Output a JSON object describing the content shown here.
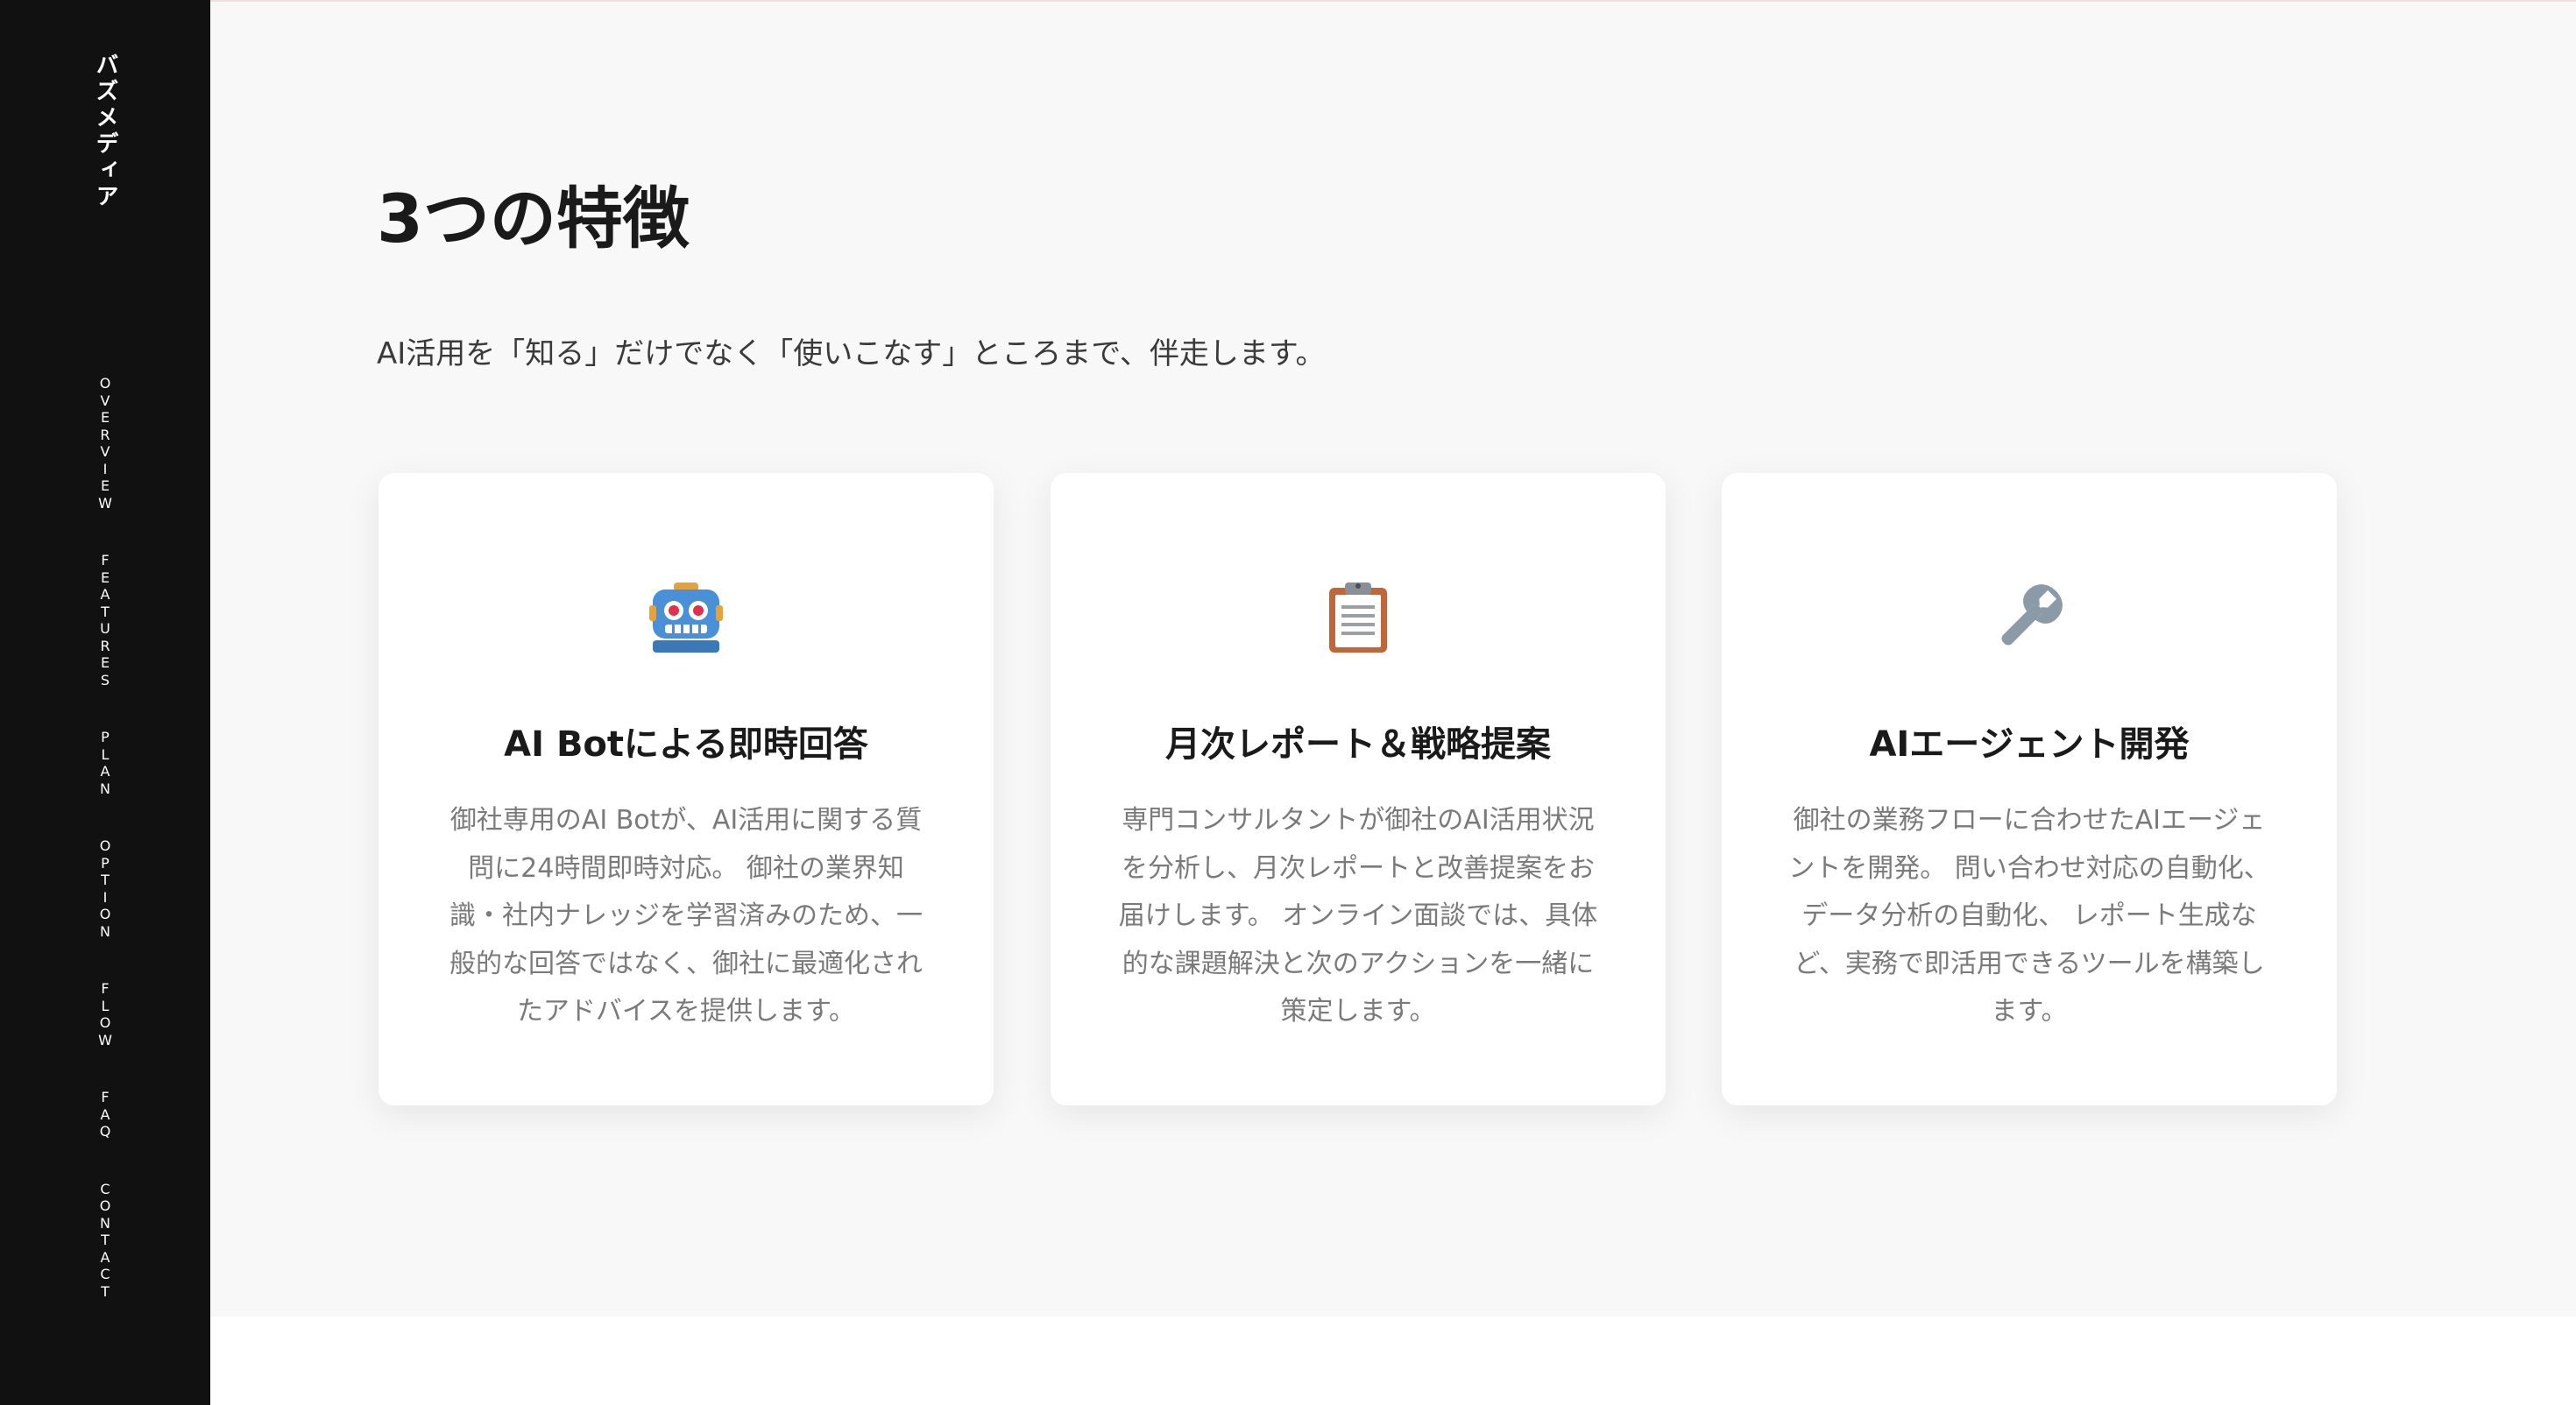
{
  "sidebar": {
    "brand": "バズメディア",
    "nav": [
      "OVERVIEW",
      "FEATURES",
      "PLAN",
      "OPTION",
      "FLOW",
      "FAQ",
      "CONTACT"
    ]
  },
  "section": {
    "title": "3つの特徴",
    "subtitle": "AI活用を「知る」だけでなく「使いこなす」ところまで、伴走します。"
  },
  "cards": [
    {
      "icon": "robot-icon",
      "title": "AI Botによる即時回答",
      "text": "御社専用のAI Botが、AI活用に関する質問に24時間即時対応。 御社の業界知識・社内ナレッジを学習済みのため、一般的な回答ではなく、御社に最適化されたアドバイスを提供します。"
    },
    {
      "icon": "clipboard-icon",
      "title": "月次レポート＆戦略提案",
      "text": "専門コンサルタントが御社のAI活用状況を分析し、月次レポートと改善提案をお届けします。 オンライン面談では、具体的な課題解決と次のアクションを一緒に策定します。"
    },
    {
      "icon": "wrench-icon",
      "title": "AIエージェント開発",
      "text": "御社の業務フローに合わせたAIエージェントを開発。 問い合わせ対応の自動化、データ分析の自動化、 レポート生成など、実務で即活用できるツールを構築します。"
    }
  ],
  "colors": {
    "sidebar_bg": "#111111",
    "main_bg": "#f8f8f8",
    "card_bg": "#ffffff",
    "robot_blue": "#4a90d9",
    "clipboard_brown": "#c1653a",
    "wrench_gray": "#8a9aa6"
  }
}
